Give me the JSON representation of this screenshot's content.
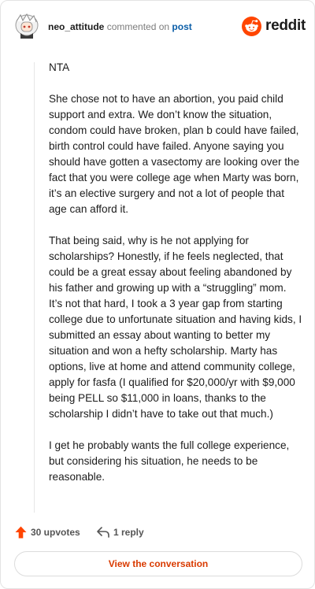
{
  "header": {
    "username": "neo_attitude",
    "action_text": "commented on",
    "post_link": "post",
    "brand": "reddit"
  },
  "comment": {
    "paragraphs": [
      "NTA",
      "She chose not to have an abortion, you paid child support and extra. We don’t know the situation, condom could have broken, plan b could have failed, birth control could have failed. Anyone saying you should have gotten a vasectomy are looking over the fact that you were college age when Marty was born, it’s an elective surgery and not a lot of people that age can afford it.",
      "That being said, why is he not applying for scholarships? Honestly, if he feels neglected, that could be a great essay about feeling abandoned by his father and growing up with a “struggling” mom. It’s not that hard, I took a 3 year gap from starting college due to unfortunate situation and having kids, I submitted an essay about wanting to better my situation and won a hefty scholarship. Marty has options, live at home and attend community college, apply for fasfa (I qualified for $20,000/yr with $9,000 being PELL so $11,000 in loans, thanks to the scholarship I didn’t have to take out that much.)",
      "I get he probably wants the full college experience, but considering his situation, he needs to be reasonable."
    ]
  },
  "actions": {
    "upvotes": "30 upvotes",
    "replies": "1 reply"
  },
  "cta": {
    "label": "View the conversation"
  },
  "colors": {
    "accent": "#ff4500",
    "link": "#0b5ea8",
    "cta_text": "#d93a00"
  }
}
